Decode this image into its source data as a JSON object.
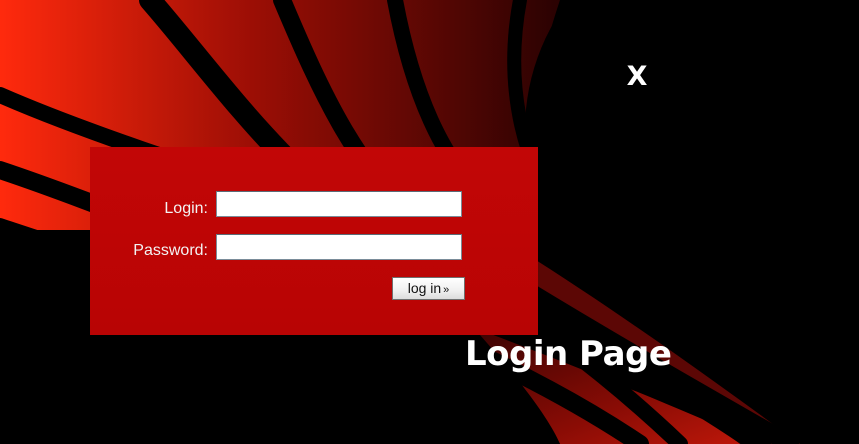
{
  "header": {
    "brand_mark": "X"
  },
  "login_form": {
    "login_label": "Login:",
    "login_value": "",
    "password_label": "Password:",
    "password_value": "",
    "submit_label": "log in",
    "submit_arrow": "»"
  },
  "page": {
    "title": "Login Page"
  },
  "colors": {
    "background": "#000000",
    "panel": "#c20606",
    "accent_bright": "#ff2a0d",
    "text_light": "#ffffff"
  },
  "icons": {
    "submit_arrow_icon": "double-chevron-right-icon"
  }
}
